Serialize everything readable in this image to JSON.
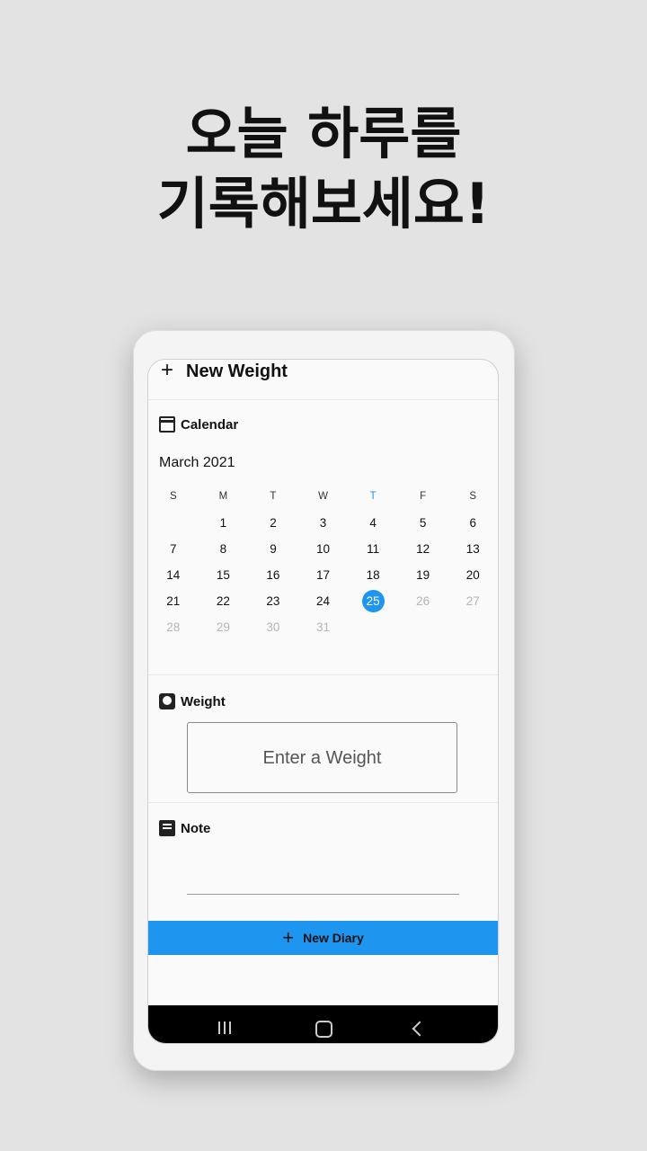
{
  "headline": {
    "line1": "오늘 하루를",
    "line2": "기록해보세요!"
  },
  "appbar": {
    "plus": "+",
    "title": "New Weight"
  },
  "calendar": {
    "section_title": "Calendar",
    "month_label": "March 2021",
    "weekdays": [
      "S",
      "M",
      "T",
      "W",
      "T",
      "F",
      "S"
    ],
    "weeks": [
      [
        "",
        "1",
        "2",
        "3",
        "4",
        "5",
        "6"
      ],
      [
        "7",
        "8",
        "9",
        "10",
        "11",
        "12",
        "13"
      ],
      [
        "14",
        "15",
        "16",
        "17",
        "18",
        "19",
        "20"
      ],
      [
        "21",
        "22",
        "23",
        "24",
        "25",
        "26",
        "27"
      ],
      [
        "28",
        "29",
        "30",
        "31",
        "",
        "",
        ""
      ]
    ],
    "selected_day": "25"
  },
  "weight": {
    "section_title": "Weight",
    "placeholder": "Enter a Weight"
  },
  "note": {
    "section_title": "Note"
  },
  "new_diary": {
    "plus": "+",
    "label": "New Diary"
  },
  "colors": {
    "accent": "#1e96f0",
    "background": "#e3e3e3"
  }
}
